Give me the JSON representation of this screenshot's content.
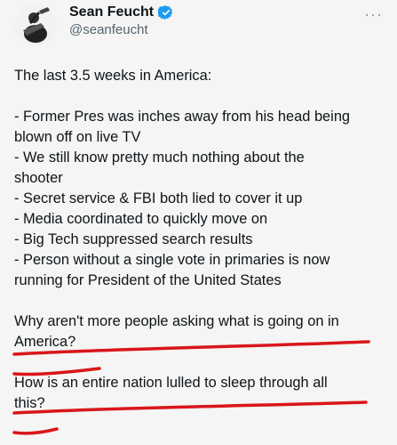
{
  "header": {
    "display_name": "Sean Feucht",
    "handle": "@seanfeucht",
    "more_label": "···"
  },
  "post": {
    "lines": [
      "The last 3.5 weeks in America:",
      "",
      "- Former Pres was inches away from his head being",
      "blown off on live TV",
      "- We still know pretty much nothing about the",
      "shooter",
      "- Secret service & FBI both lied to cover it up",
      "- Media coordinated to quickly move on",
      "- Big Tech suppressed search results",
      "- Person without a single vote in primaries is now",
      "running for President of the United States",
      "",
      "Why aren't more people asking what is going on in",
      "America?",
      "",
      "How is an entire nation lulled to sleep through all",
      "this?"
    ]
  },
  "colors": {
    "text": "#0f1419",
    "muted": "#536471",
    "verified": "#1d9bf0",
    "underline": "#d9161b",
    "background": "#f4f5f4"
  },
  "icons": {
    "verified": "verified-badge-icon",
    "more": "more-options-icon"
  }
}
